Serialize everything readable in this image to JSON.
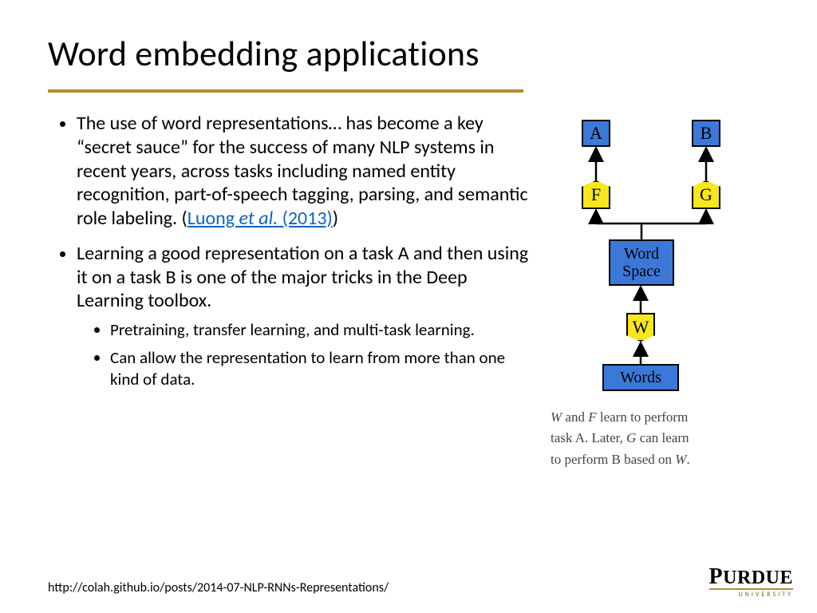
{
  "title": "Word embedding applications",
  "bullets": {
    "b1_pre": "The use of word representations… has become a key “secret sauce” for the success of many NLP systems in recent years, across tasks including named entity recognition, part-of-speech tagging, parsing, and semantic role labeling. (",
    "b1_link_pre": "Luong ",
    "b1_link_em": "et al.",
    "b1_link_post": " (2013)",
    "b1_post": ")",
    "b2": "Learning a good representation on a task A and then using it on a task B is one of the major tricks in the Deep Learning toolbox.",
    "b2a": "Pretraining, transfer learning, and multi-task learning.",
    "b2b": "Can allow the representation to learn from more than one kind of data."
  },
  "diagram": {
    "A": "A",
    "B": "B",
    "F": "F",
    "G": "G",
    "WS": "Word\nSpace",
    "W": "W",
    "Words": "Words"
  },
  "caption": {
    "t1a": "W",
    "t1b": " and ",
    "t1c": "F",
    "t1d": " learn to perform",
    "t2a": "task A. Later, ",
    "t2b": "G",
    "t2c": " can learn",
    "t3a": "to perform B based on ",
    "t3b": "W",
    "t3c": "."
  },
  "footer_url": "http://colah.github.io/posts/2014-07-NLP-RNNs-Representations/",
  "logo": {
    "name": "PURDUE",
    "sub": "UNIVERSITY"
  }
}
